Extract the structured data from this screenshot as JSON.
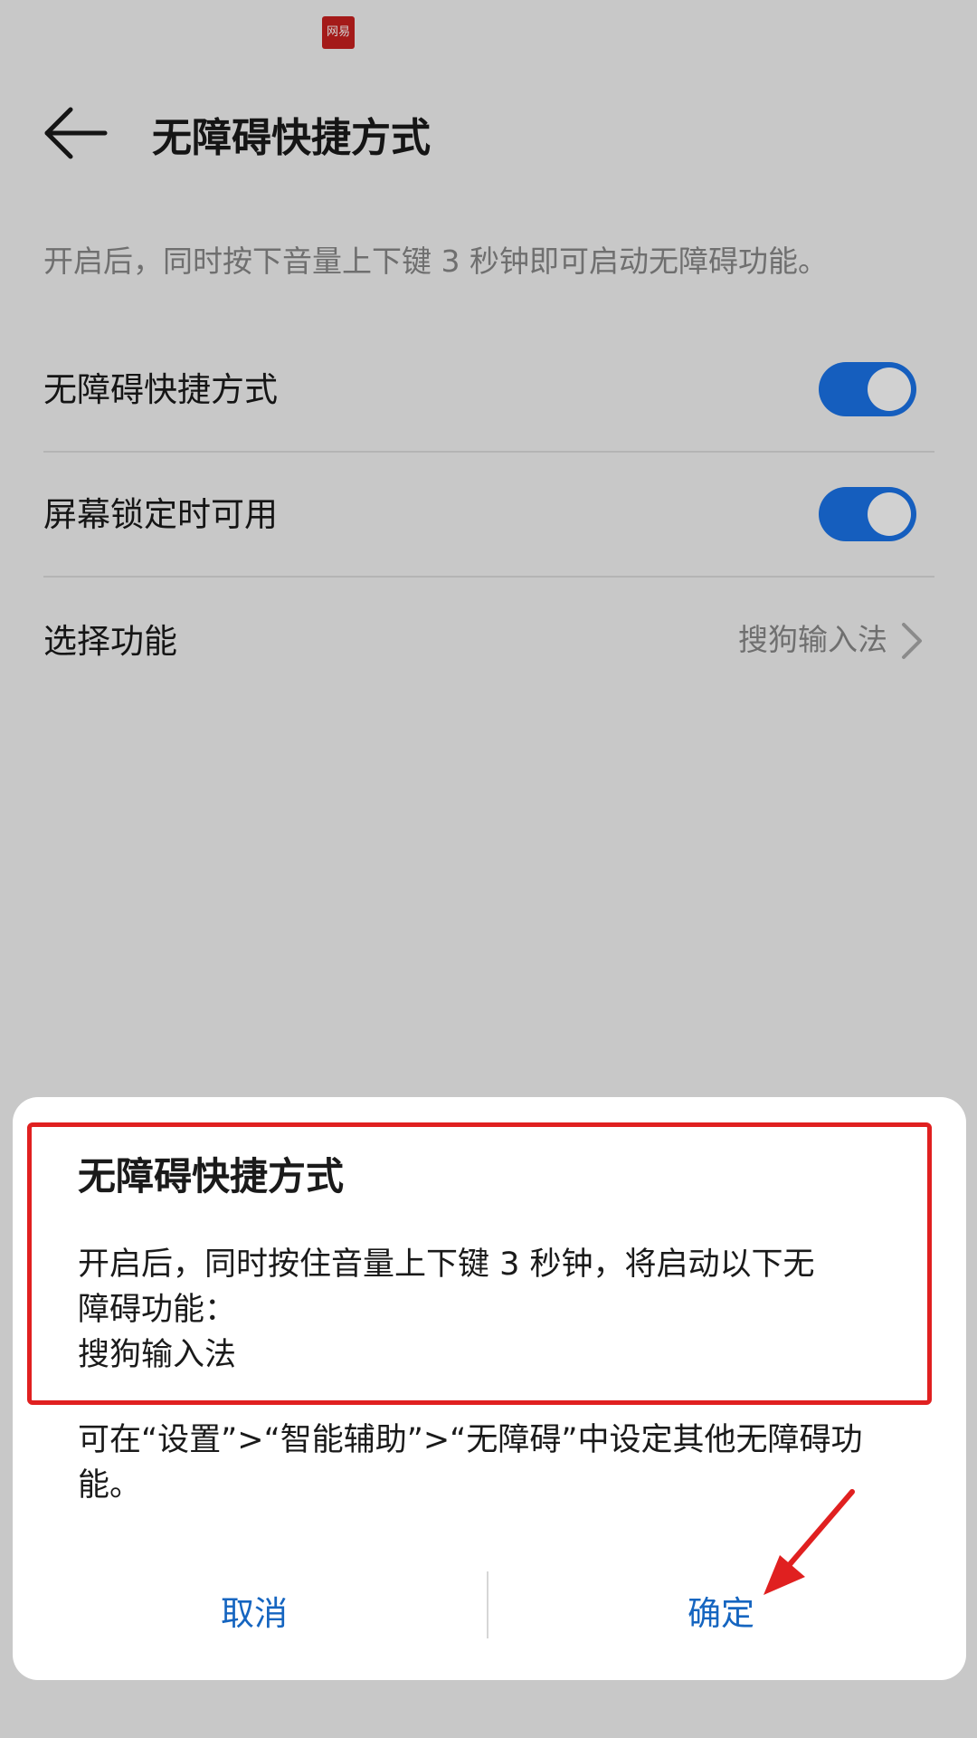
{
  "status_bar": {
    "app_logo_text": "网易"
  },
  "header": {
    "title": "无障碍快捷方式"
  },
  "description": "开启后，同时按下音量上下键 3 秒钟即可启动无障碍功能。",
  "settings": [
    {
      "label": "无障碍快捷方式",
      "toggle": true
    },
    {
      "label": "屏幕锁定时可用",
      "toggle": true
    },
    {
      "label": "选择功能",
      "value": "搜狗输入法"
    }
  ],
  "dialog": {
    "title": "无障碍快捷方式",
    "message_line1": "开启后，同时按住音量上下键 3 秒钟，将启动以下无",
    "message_line2": "障碍功能：",
    "message_line3": "搜狗输入法",
    "note_line1": "可在“设置”>“智能辅助”>“无障碍”中设定其他无障碍功",
    "note_line2": "能。",
    "cancel_label": "取消",
    "confirm_label": "确定"
  },
  "colors": {
    "accent": "#1a73e8",
    "button_text": "#1565c0",
    "highlight": "#e02020"
  }
}
